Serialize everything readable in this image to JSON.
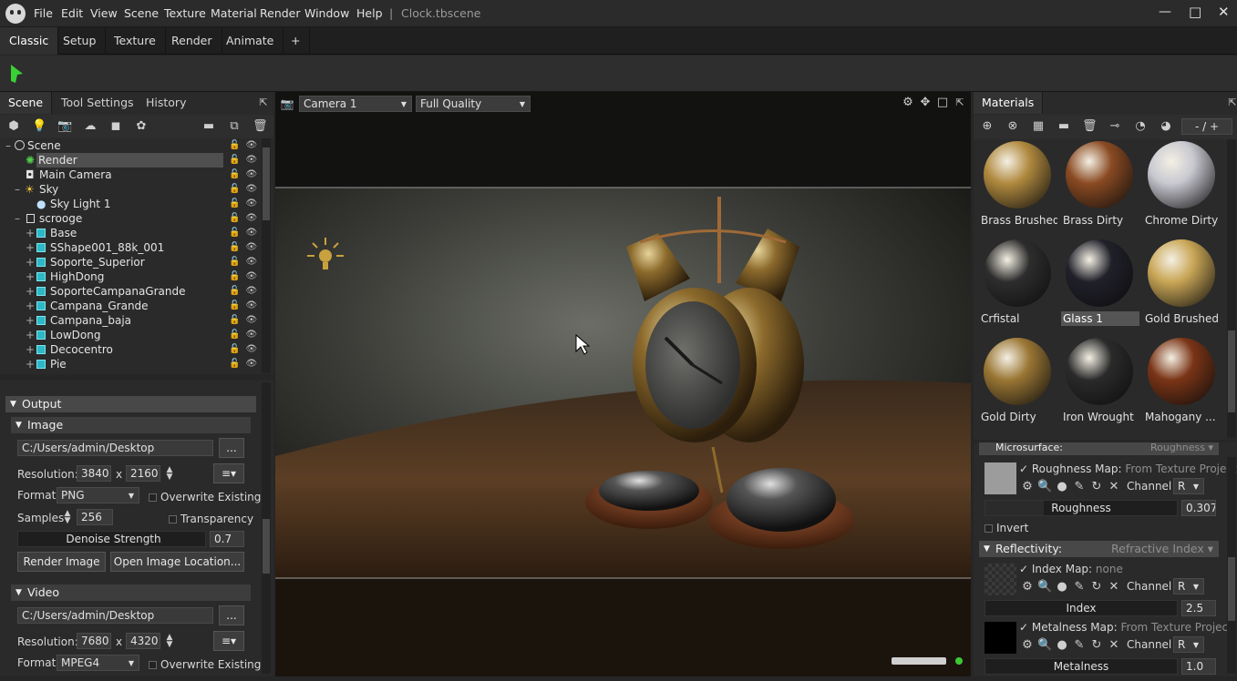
{
  "titlebar": {
    "menus": [
      "File",
      "Edit",
      "View",
      "Scene",
      "Texture",
      "Material",
      "Render",
      "Window",
      "Help"
    ],
    "separator": "|",
    "title": "Clock.tbscene",
    "controls": {
      "minimize": "—",
      "maximize": "□",
      "close": "✕"
    }
  },
  "workspace_tabs": [
    "Classic",
    "Setup",
    "Texture",
    "Render",
    "Animate",
    "+"
  ],
  "scene_panel": {
    "tabs": [
      "Scene",
      "Tool Settings",
      "History"
    ],
    "tree": [
      {
        "label": "Scene",
        "depth": 0,
        "expander": "–"
      },
      {
        "label": "Render",
        "depth": 1,
        "selected": true
      },
      {
        "label": "Main Camera",
        "depth": 1
      },
      {
        "label": "Sky",
        "depth": 1,
        "expander": "–"
      },
      {
        "label": "Sky Light 1",
        "depth": 2
      },
      {
        "label": "scrooge",
        "depth": 1,
        "expander": "–"
      },
      {
        "label": "Base",
        "depth": 2,
        "expander": "+"
      },
      {
        "label": "SShape001_88k_001",
        "depth": 2,
        "expander": "+"
      },
      {
        "label": "Soporte_Superior",
        "depth": 2,
        "expander": "+"
      },
      {
        "label": "HighDong",
        "depth": 2,
        "expander": "+"
      },
      {
        "label": "SoporteCampanaGrande",
        "depth": 2,
        "expander": "+"
      },
      {
        "label": "Campana_Grande",
        "depth": 2,
        "expander": "+"
      },
      {
        "label": "Campana_baja",
        "depth": 2,
        "expander": "+"
      },
      {
        "label": "LowDong",
        "depth": 2,
        "expander": "+"
      },
      {
        "label": "Decocentro",
        "depth": 2,
        "expander": "+"
      },
      {
        "label": "Pie",
        "depth": 2,
        "expander": "+"
      }
    ]
  },
  "output_panel": {
    "output_header": "Output",
    "image": {
      "header": "Image",
      "path": "C:/Users/admin/Desktop",
      "browse": "...",
      "resolution_label": "Resolution:",
      "width": "3840",
      "x": "x",
      "height": "2160",
      "menu": "≡▾",
      "format_label": "Format",
      "format": "PNG",
      "overwrite": "Overwrite Existing",
      "samples_label": "Samples",
      "samples": "256",
      "transparency": "Transparency",
      "denoise_label": "Denoise Strength",
      "denoise_value": "0.7",
      "render_button": "Render Image",
      "open_button": "Open Image Location..."
    },
    "video": {
      "header": "Video",
      "path": "C:/Users/admin/Desktop",
      "browse": "...",
      "resolution_label": "Resolution:",
      "width": "7680",
      "x": "x",
      "height": "4320",
      "menu": "≡▾",
      "format_label": "Format",
      "format": "MPEG4",
      "overwrite": "Overwrite Existing"
    }
  },
  "viewport": {
    "camera": "Camera 1",
    "quality": "Full Quality"
  },
  "materials_panel": {
    "tab": "Materials",
    "page": "- / +",
    "items": [
      {
        "name": "Brass Brushed",
        "color": "#b0893e"
      },
      {
        "name": "Brass Dirty",
        "color": "#8a4a22"
      },
      {
        "name": "Chrome Dirty",
        "color": "#c8c8d0"
      },
      {
        "name": "Crfistal",
        "color": "#2d2d2d"
      },
      {
        "name": "Glass 1",
        "color": "#20202a",
        "selected": true
      },
      {
        "name": "Gold Brushed",
        "color": "#c9a656"
      },
      {
        "name": "Gold Dirty",
        "color": "#9a7634"
      },
      {
        "name": "Iron Wrought",
        "color": "#2a2a2a"
      },
      {
        "name": "Mahogany ...",
        "color": "#7a3416"
      }
    ]
  },
  "properties": {
    "microsurface": {
      "header": "Microsurface:",
      "mode": "Roughness ▾"
    },
    "roughness_map": {
      "label": "Roughness Map:",
      "source": "From Texture Project",
      "channel_label": "Channel",
      "channel": "R"
    },
    "roughness": {
      "label": "Roughness",
      "value": "0.307",
      "fill": 0.307
    },
    "invert": "Invert",
    "reflectivity": {
      "header": "Reflectivity:",
      "mode": "Refractive Index ▾"
    },
    "index_map": {
      "label": "Index Map:",
      "source": "none",
      "channel_label": "Channel",
      "channel": "R"
    },
    "index": {
      "label": "Index",
      "value": "2.5"
    },
    "metalness_map": {
      "label": "Metalness Map:",
      "source": "From Texture Project",
      "channel_label": "Channel",
      "channel": "R"
    },
    "metalness": {
      "label": "Metalness",
      "value": "1.0"
    }
  }
}
